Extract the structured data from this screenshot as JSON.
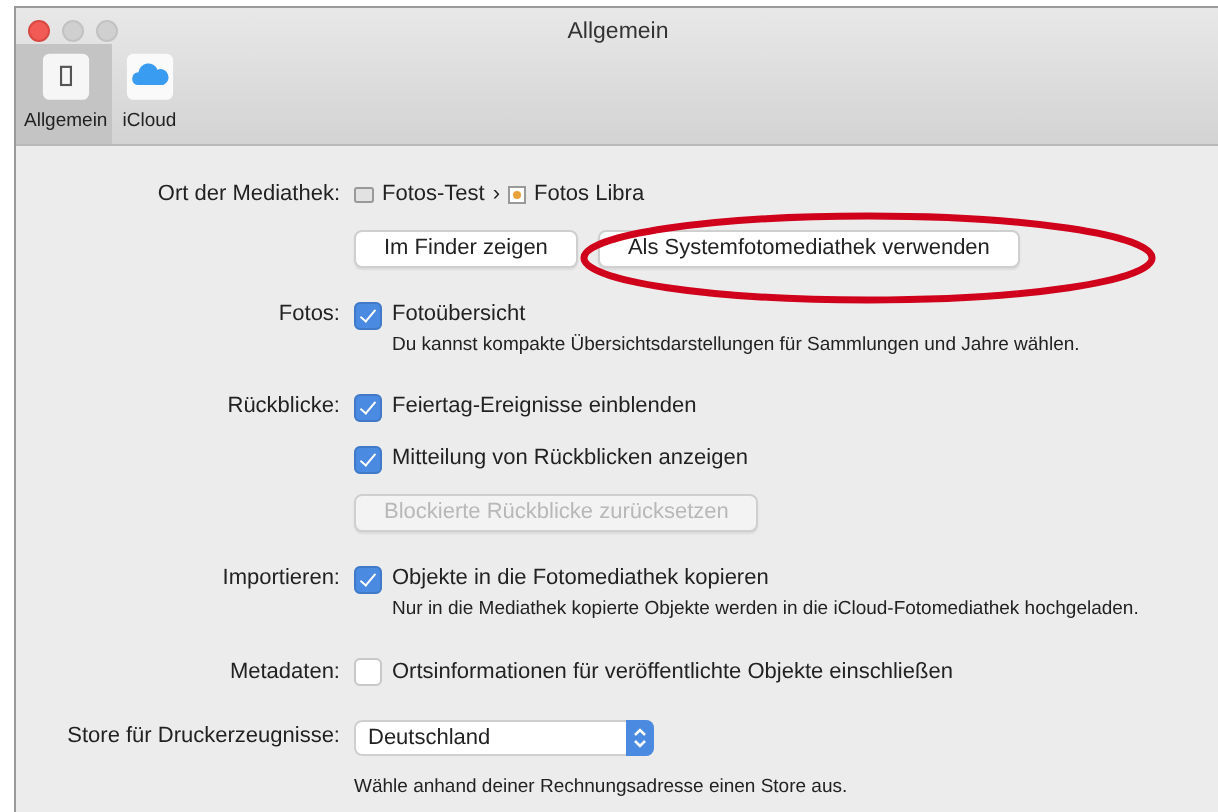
{
  "window": {
    "title": "Allgemein",
    "close_active": true
  },
  "toolbar": {
    "tabs": [
      {
        "label": "Allgemein",
        "kind": "device",
        "selected": true
      },
      {
        "label": "iCloud",
        "kind": "cloud",
        "selected": false
      }
    ]
  },
  "sections": [
    {
      "label": "Ort der Mediathek:",
      "items": [
        {
          "kind": "path",
          "segments": [
            "Fotos-Test",
            "Fotos Libra"
          ],
          "separator": "›"
        },
        {
          "kind": "buttons",
          "buttons": [
            {
              "label": "Im Finder zeigen",
              "highlighted": false
            },
            {
              "label": "Als Systemfotomediathek verwenden",
              "highlighted": true
            }
          ]
        }
      ]
    },
    {
      "label": "Fotos:",
      "items": [
        {
          "kind": "checkbox",
          "label": "Fotoübersicht",
          "checked": true
        },
        {
          "kind": "note",
          "text": "Du kannst kompakte Übersichtsdarstellungen für Sammlungen und Jahre wählen."
        }
      ]
    },
    {
      "label": "Rückblicke:",
      "items": [
        {
          "kind": "checkbox",
          "label": "Feiertag-Ereignisse einblenden",
          "checked": true
        },
        {
          "kind": "checkbox",
          "label": "Mitteilung von Rückblicken anzeigen",
          "checked": true
        },
        {
          "kind": "button",
          "label": "Blockierte Rückblicke zurücksetzen",
          "disabled": true
        }
      ]
    },
    {
      "label": "Importieren:",
      "items": [
        {
          "kind": "checkbox",
          "label": "Objekte in die Fotomediathek kopieren",
          "checked": true
        },
        {
          "kind": "note",
          "text": "Nur in die Mediathek kopierte Objekte werden in die iCloud-Fotomediathek hochgeladen."
        }
      ]
    },
    {
      "label": "Metadaten:",
      "items": [
        {
          "kind": "checkbox",
          "label": "Ortsinformationen für veröffentlichte Objekte einschließen",
          "checked": false
        }
      ]
    },
    {
      "label": "Store für Druckerzeugnisse:",
      "items": [
        {
          "kind": "select",
          "value": "Deutschland"
        },
        {
          "kind": "note",
          "text": "Wähle anhand deiner Rechnungsadresse einen Store aus."
        }
      ]
    }
  ]
}
